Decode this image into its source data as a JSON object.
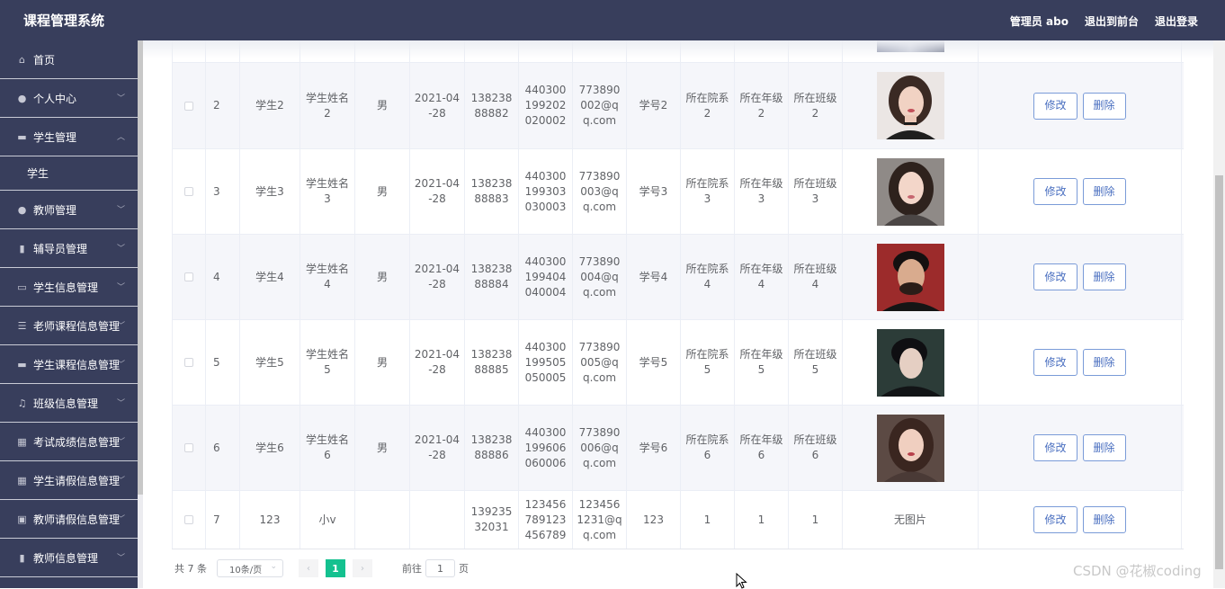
{
  "header": {
    "title": "课程管理系统",
    "links": [
      "管理员 abo",
      "退出到前台",
      "退出登录"
    ]
  },
  "sidebar": {
    "items": [
      {
        "label": "首页",
        "icon": "home-icon",
        "expanded": false
      },
      {
        "label": "个人中心",
        "icon": "user-icon",
        "expanded": false
      },
      {
        "label": "学生管理",
        "icon": "id-card-icon",
        "expanded": true
      },
      {
        "label": "教师管理",
        "icon": "user-icon",
        "expanded": false
      },
      {
        "label": "辅导员管理",
        "icon": "book-icon",
        "expanded": false
      },
      {
        "label": "学生信息管理",
        "icon": "monitor-icon",
        "expanded": false
      },
      {
        "label": "老师课程信息管理",
        "icon": "list-icon",
        "expanded": false
      },
      {
        "label": "学生课程信息管理",
        "icon": "monitor-icon",
        "expanded": false
      },
      {
        "label": "班级信息管理",
        "icon": "bell-icon",
        "expanded": false
      },
      {
        "label": "考试成绩信息管理",
        "icon": "grid-icon",
        "expanded": false
      },
      {
        "label": "学生请假信息管理",
        "icon": "table-icon",
        "expanded": false
      },
      {
        "label": "教师请假信息管理",
        "icon": "document-icon",
        "expanded": false
      },
      {
        "label": "教师信息管理",
        "icon": "book-icon",
        "expanded": false
      }
    ],
    "submenu": {
      "label": "学生"
    }
  },
  "table": {
    "rows": [
      {
        "index": "2",
        "username": "学生2",
        "name": "学生姓名2",
        "sex": "男",
        "birth": "2021-04-28",
        "phone": "13823888882",
        "idcard": "440300199202020002",
        "email": "773890002@qq.com",
        "student_no": "学号2",
        "dept": "所在院系2",
        "grade": "所在年级2",
        "class": "所在班级2",
        "photo": "photo-female-1",
        "no_photo": ""
      },
      {
        "index": "3",
        "username": "学生3",
        "name": "学生姓名3",
        "sex": "男",
        "birth": "2021-04-28",
        "phone": "13823888883",
        "idcard": "440300199303030003",
        "email": "773890003@qq.com",
        "student_no": "学号3",
        "dept": "所在院系3",
        "grade": "所在年级3",
        "class": "所在班级3",
        "photo": "photo-female-2",
        "no_photo": ""
      },
      {
        "index": "4",
        "username": "学生4",
        "name": "学生姓名4",
        "sex": "男",
        "birth": "2021-04-28",
        "phone": "13823888884",
        "idcard": "440300199404040004",
        "email": "773890004@qq.com",
        "student_no": "学号4",
        "dept": "所在院系4",
        "grade": "所在年级4",
        "class": "所在班级4",
        "photo": "photo-male-1",
        "no_photo": ""
      },
      {
        "index": "5",
        "username": "学生5",
        "name": "学生姓名5",
        "sex": "男",
        "birth": "2021-04-28",
        "phone": "13823888885",
        "idcard": "440300199505050005",
        "email": "773890005@qq.com",
        "student_no": "学号5",
        "dept": "所在院系5",
        "grade": "所在年级5",
        "class": "所在班级5",
        "photo": "photo-male-2",
        "no_photo": ""
      },
      {
        "index": "6",
        "username": "学生6",
        "name": "学生姓名6",
        "sex": "男",
        "birth": "2021-04-28",
        "phone": "13823888886",
        "idcard": "440300199606060006",
        "email": "773890006@qq.com",
        "student_no": "学号6",
        "dept": "所在院系6",
        "grade": "所在年级6",
        "class": "所在班级6",
        "photo": "photo-female-3",
        "no_photo": ""
      },
      {
        "index": "7",
        "username": "123",
        "name": "小v",
        "sex": "",
        "birth": "",
        "phone": "13923532031",
        "idcard": "123456789123456789",
        "email": "1234561231@qq.com",
        "student_no": "123",
        "dept": "1",
        "grade": "1",
        "class": "1",
        "photo": "",
        "no_photo": "无图片"
      }
    ],
    "edit_label": "修改",
    "delete_label": "删除"
  },
  "pagination": {
    "total": "共 7 条",
    "page_size": "10条/页",
    "current_page": "1",
    "goto_prefix": "前往",
    "goto_value": "1",
    "goto_suffix": "页",
    "prev_icon": "chevron-left-icon",
    "next_icon": "chevron-right-icon"
  },
  "watermark": "CSDN @花椒coding",
  "colors": {
    "header_bg": "#383e5c",
    "sidebar_bg": "#383e5c",
    "accent_green": "#14c18f",
    "button_border": "#7a9bd8",
    "row_stripe": "#f5f6fa"
  }
}
